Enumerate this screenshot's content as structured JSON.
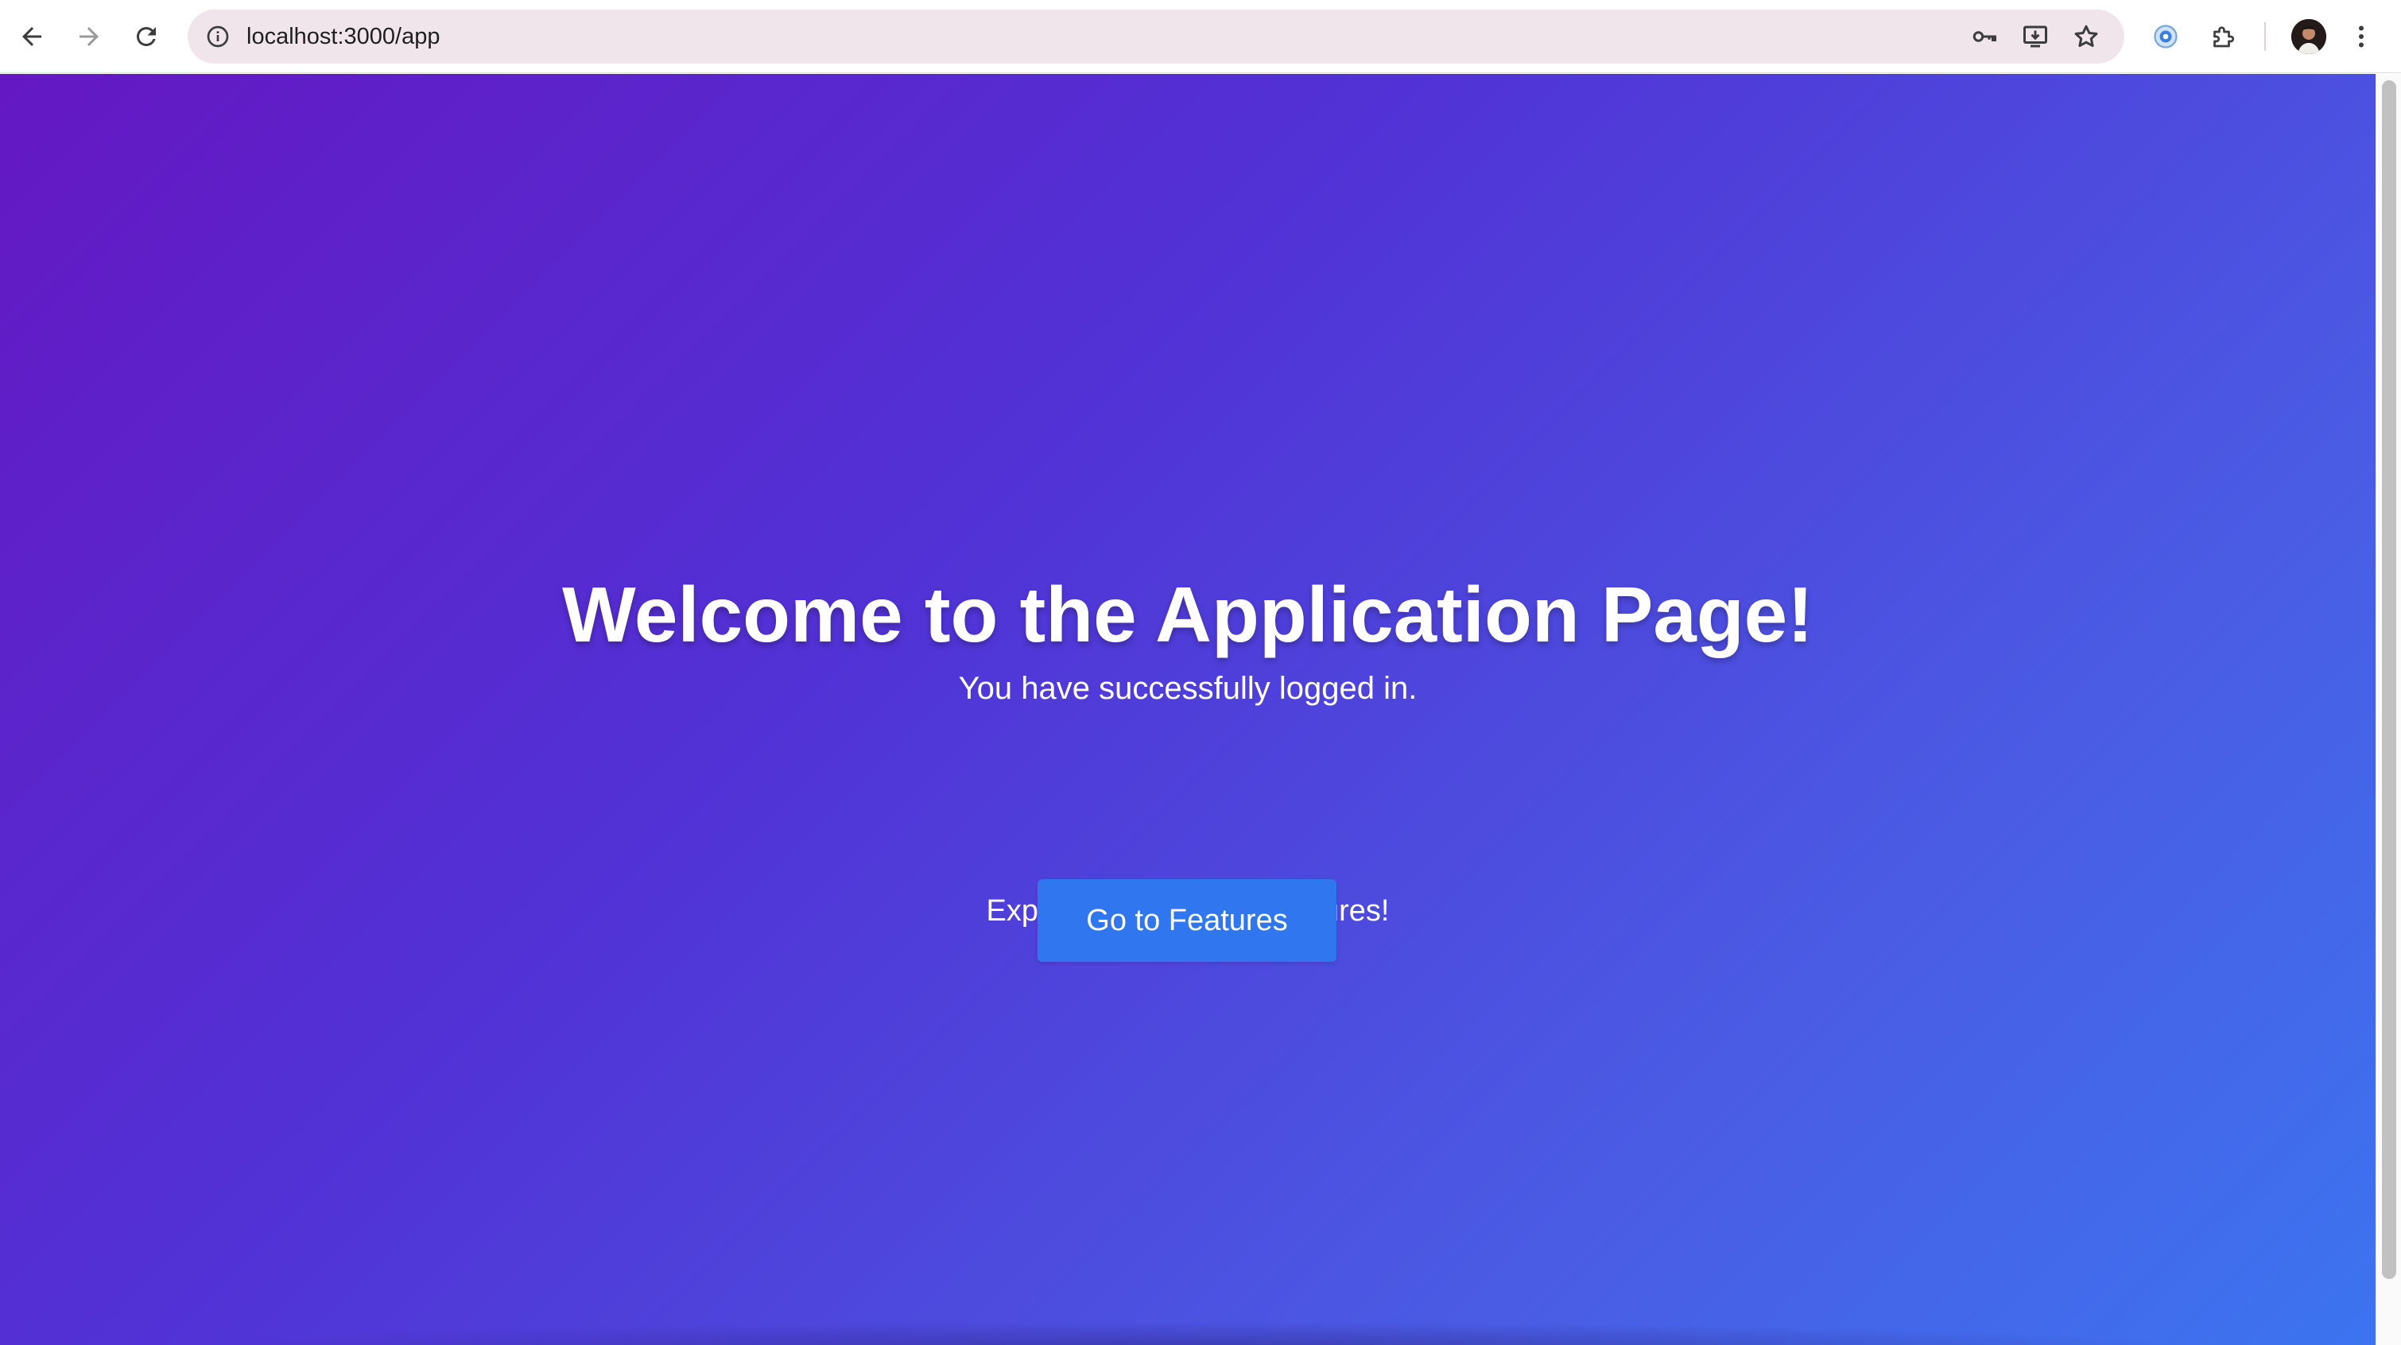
{
  "browser": {
    "url": "localhost:3000/app",
    "icons": {
      "back": "arrow-left-icon",
      "forward": "arrow-right-icon",
      "reload": "reload-icon",
      "site_info": "info-icon",
      "passwords": "key-icon",
      "install": "install-app-icon",
      "bookmark": "star-icon",
      "extension": "extension-badge-icon",
      "extensions": "puzzle-icon",
      "profile": "avatar",
      "menu": "kebab-menu-icon"
    }
  },
  "page": {
    "title": "Welcome to the Application Page!",
    "subtitle": "You have successfully logged in.",
    "explore_text": "Explore our amazing features!",
    "cta_label": "Go to Features",
    "colors": {
      "gradient_start": "#6418c3",
      "gradient_end": "#3c74f0",
      "button": "#2f76ef",
      "text": "#ffffff"
    }
  }
}
